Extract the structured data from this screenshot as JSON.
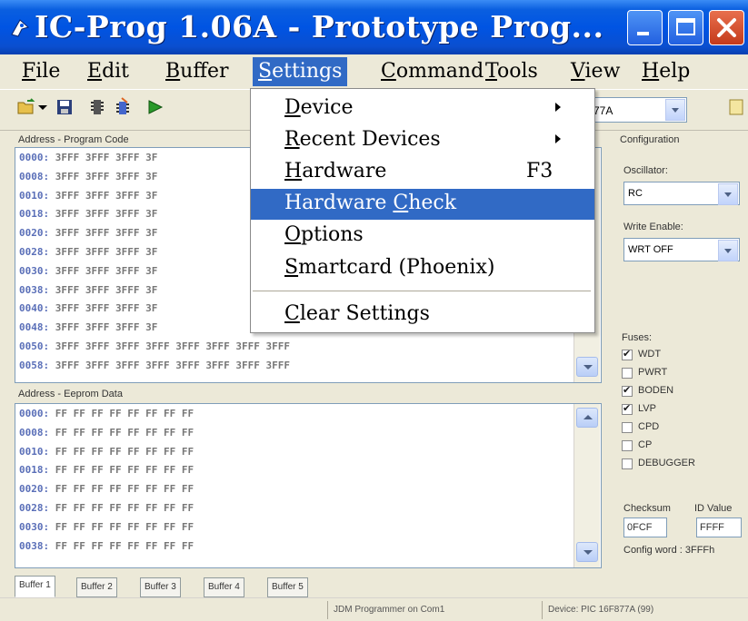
{
  "window": {
    "title": "IC-Prog 1.06A - Prototype Prog...",
    "colors": {
      "titlebar": "#0054e3",
      "highlight": "#316ac5",
      "close": "#c43a1b"
    }
  },
  "menubar": {
    "items": [
      {
        "first": "F",
        "rest": "ile"
      },
      {
        "first": "E",
        "rest": "dit"
      },
      {
        "first": "B",
        "rest": "uffer"
      },
      {
        "first": "S",
        "rest": "ettings"
      },
      {
        "first": "C",
        "rest": "ommand"
      },
      {
        "first": "T",
        "rest": "ools"
      },
      {
        "first": "V",
        "rest": "iew"
      },
      {
        "first": "H",
        "rest": "elp"
      }
    ]
  },
  "toolbar": {
    "device_value": "77A"
  },
  "program_panel": {
    "label": "Address - Program Code",
    "rows": [
      {
        "addr": "0000:",
        "data": "3FFF 3FFF 3FFF 3F"
      },
      {
        "addr": "0008:",
        "data": "3FFF 3FFF 3FFF 3F"
      },
      {
        "addr": "0010:",
        "data": "3FFF 3FFF 3FFF 3F"
      },
      {
        "addr": "0018:",
        "data": "3FFF 3FFF 3FFF 3F"
      },
      {
        "addr": "0020:",
        "data": "3FFF 3FFF 3FFF 3F"
      },
      {
        "addr": "0028:",
        "data": "3FFF 3FFF 3FFF 3F"
      },
      {
        "addr": "0030:",
        "data": "3FFF 3FFF 3FFF 3F"
      },
      {
        "addr": "0038:",
        "data": "3FFF 3FFF 3FFF 3F"
      },
      {
        "addr": "0040:",
        "data": "3FFF 3FFF 3FFF 3F"
      },
      {
        "addr": "0048:",
        "data": "3FFF 3FFF 3FFF 3F"
      },
      {
        "addr": "0050:",
        "data": "3FFF 3FFF 3FFF 3FFF 3FFF 3FFF 3FFF 3FFF"
      },
      {
        "addr": "0058:",
        "data": "3FFF 3FFF 3FFF 3FFF 3FFF 3FFF 3FFF 3FFF"
      }
    ]
  },
  "eeprom_panel": {
    "label": "Address - Eeprom Data",
    "rows": [
      {
        "addr": "0000:",
        "data": "FF FF FF FF FF FF FF FF"
      },
      {
        "addr": "0008:",
        "data": "FF FF FF FF FF FF FF FF"
      },
      {
        "addr": "0010:",
        "data": "FF FF FF FF FF FF FF FF"
      },
      {
        "addr": "0018:",
        "data": "FF FF FF FF FF FF FF FF"
      },
      {
        "addr": "0020:",
        "data": "FF FF FF FF FF FF FF FF"
      },
      {
        "addr": "0028:",
        "data": "FF FF FF FF FF FF FF FF"
      },
      {
        "addr": "0030:",
        "data": "FF FF FF FF FF FF FF FF"
      },
      {
        "addr": "0038:",
        "data": "FF FF FF FF FF FF FF FF"
      }
    ]
  },
  "config": {
    "title": "Configuration",
    "oscillator_label": "Oscillator:",
    "oscillator_value": "RC",
    "write_enable_label": "Write Enable:",
    "write_enable_value": "WRT OFF",
    "fuses_label": "Fuses:",
    "fuses": [
      {
        "name": "WDT",
        "checked": true
      },
      {
        "name": "PWRT",
        "checked": false
      },
      {
        "name": "BODEN",
        "checked": true
      },
      {
        "name": "LVP",
        "checked": true
      },
      {
        "name": "CPD",
        "checked": false
      },
      {
        "name": "CP",
        "checked": false
      },
      {
        "name": "DEBUGGER",
        "checked": false
      }
    ],
    "checksum_label": "Checksum",
    "id_label": "ID Value",
    "checksum_value": "0FCF",
    "id_value": "FFFF",
    "config_word": "Config word : 3FFFh"
  },
  "tabs": [
    "Buffer 1",
    "Buffer 2",
    "Buffer 3",
    "Buffer 4",
    "Buffer 5"
  ],
  "status": {
    "programmer": "JDM Programmer on Com1",
    "device": "Device: PIC 16F877A  (99)"
  },
  "settings_menu": {
    "items": [
      {
        "first": "D",
        "rest": "evice",
        "shortcut": "",
        "submenu": true
      },
      {
        "first": "R",
        "rest": "ecent Devices",
        "shortcut": "",
        "submenu": true
      },
      {
        "first": "H",
        "rest": "ardware",
        "shortcut": "F3",
        "submenu": false
      },
      {
        "pre": "Hardware ",
        "first": "C",
        "rest": "heck",
        "shortcut": "",
        "submenu": false,
        "highlighted": true
      },
      {
        "first": "O",
        "rest": "ptions",
        "shortcut": "",
        "submenu": false
      },
      {
        "first": "S",
        "rest": "martcard (Phoenix)",
        "shortcut": "",
        "submenu": false
      },
      {
        "first": "C",
        "rest": "lear Settings",
        "shortcut": "",
        "submenu": false
      }
    ]
  }
}
